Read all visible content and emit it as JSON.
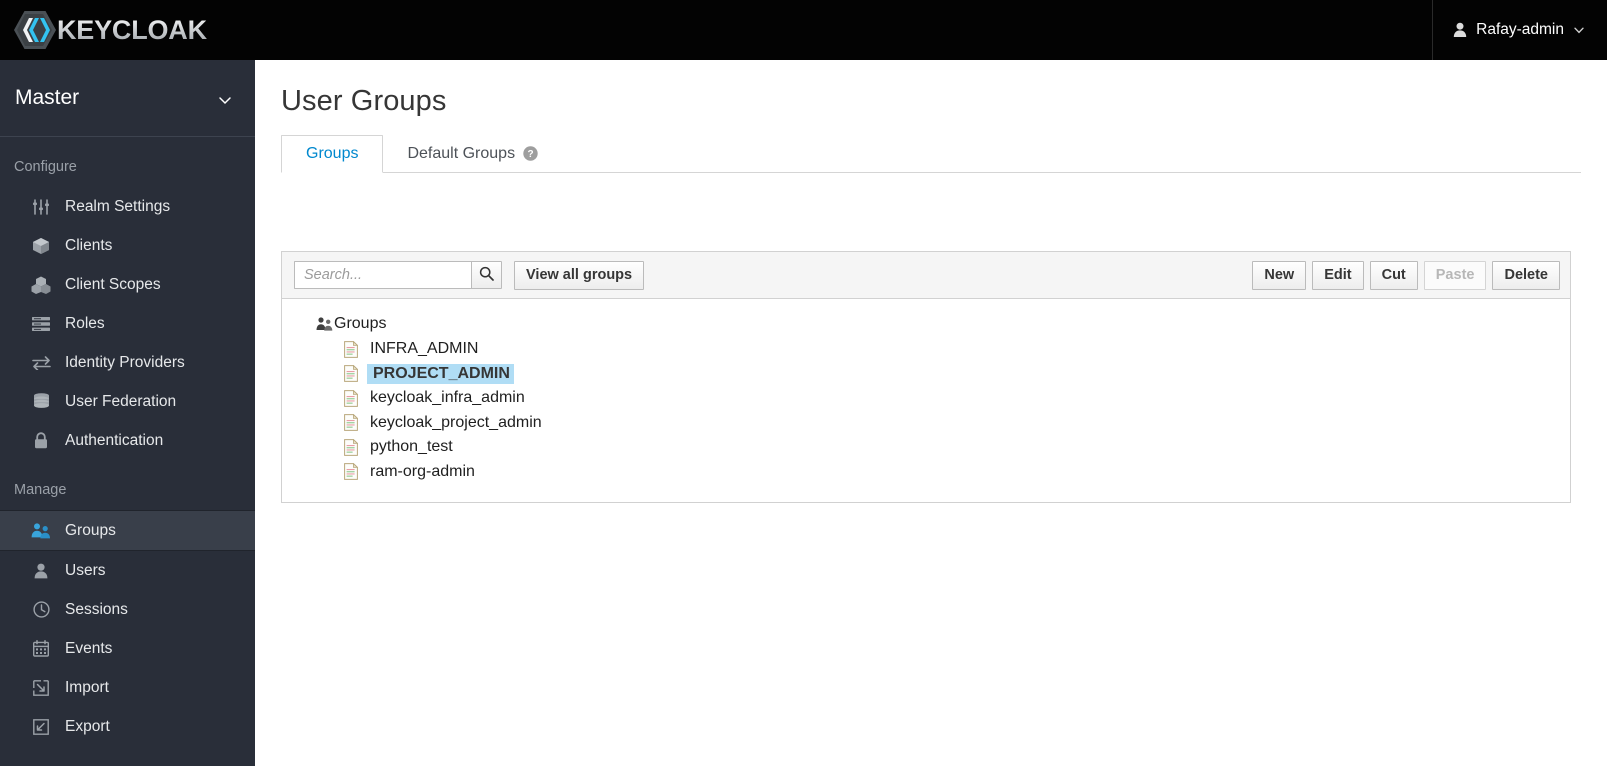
{
  "masthead": {
    "brand_text": "KEYCLOAK",
    "brand_logo_icon": "keycloak-hexagon-logo",
    "user_icon": "user-icon",
    "user_name": "Rafay-admin",
    "caret_icon": "chevron-down-icon"
  },
  "sidebar": {
    "realm": {
      "name": "Master",
      "caret_icon": "chevron-down-icon"
    },
    "sections": [
      {
        "label": "Configure",
        "items": [
          {
            "label": "Realm Settings",
            "icon": "sliders-icon",
            "active": false
          },
          {
            "label": "Clients",
            "icon": "cube-icon",
            "active": false
          },
          {
            "label": "Client Scopes",
            "icon": "cubes-icon",
            "active": false
          },
          {
            "label": "Roles",
            "icon": "list-rows-icon",
            "active": false
          },
          {
            "label": "Identity Providers",
            "icon": "exchange-arrows-icon",
            "active": false
          },
          {
            "label": "User Federation",
            "icon": "database-icon",
            "active": false
          },
          {
            "label": "Authentication",
            "icon": "lock-icon",
            "active": false
          }
        ]
      },
      {
        "label": "Manage",
        "items": [
          {
            "label": "Groups",
            "icon": "users-group-icon",
            "active": true
          },
          {
            "label": "Users",
            "icon": "user-icon",
            "active": false
          },
          {
            "label": "Sessions",
            "icon": "clock-icon",
            "active": false
          },
          {
            "label": "Events",
            "icon": "calendar-icon",
            "active": false
          },
          {
            "label": "Import",
            "icon": "import-arrow-icon",
            "active": false
          },
          {
            "label": "Export",
            "icon": "export-arrow-icon",
            "active": false
          }
        ]
      }
    ]
  },
  "main": {
    "page_title": "User Groups",
    "tabs": [
      {
        "label": "Groups",
        "active": true,
        "help": false
      },
      {
        "label": "Default Groups",
        "active": false,
        "help": true,
        "help_icon": "question-circle-icon"
      }
    ],
    "toolbar": {
      "search_placeholder": "Search...",
      "search_value": "",
      "search_icon": "search-icon",
      "view_all_label": "View all groups",
      "actions": [
        {
          "label": "New",
          "disabled": false
        },
        {
          "label": "Edit",
          "disabled": false
        },
        {
          "label": "Cut",
          "disabled": false
        },
        {
          "label": "Paste",
          "disabled": true
        },
        {
          "label": "Delete",
          "disabled": false
        }
      ]
    },
    "tree": {
      "root_label": "Groups",
      "root_icon": "users-group-icon",
      "children": [
        {
          "label": "INFRA_ADMIN",
          "icon": "document-icon",
          "selected": false
        },
        {
          "label": "PROJECT_ADMIN",
          "icon": "document-icon",
          "selected": true
        },
        {
          "label": "keycloak_infra_admin",
          "icon": "document-icon",
          "selected": false
        },
        {
          "label": "keycloak_project_admin",
          "icon": "document-icon",
          "selected": false
        },
        {
          "label": "python_test",
          "icon": "document-icon",
          "selected": false
        },
        {
          "label": "ram-org-admin",
          "icon": "document-icon",
          "selected": false
        }
      ]
    }
  },
  "colors": {
    "masthead_bg": "#030303",
    "sidebar_bg": "#292e39",
    "sidebar_active_bg": "#393f4a",
    "accent_blue": "#0088ce",
    "selection_blue": "#b0ddf5",
    "logo_cyan": "#33c3f0"
  }
}
